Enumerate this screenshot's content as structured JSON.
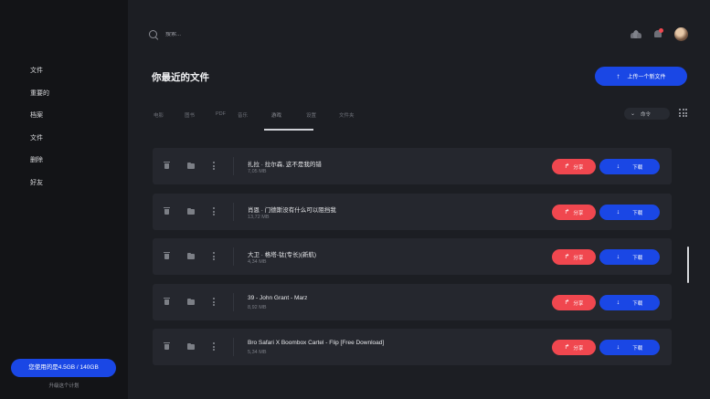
{
  "sidebar": {
    "items": [
      {
        "label": "文件"
      },
      {
        "label": "重要的"
      },
      {
        "label": "档案"
      },
      {
        "label": "文件"
      },
      {
        "label": "删除"
      },
      {
        "label": "好友"
      }
    ],
    "storage_label": "您使用的是4.5GB / 140GB",
    "upgrade_label": "升级这个计划"
  },
  "header": {
    "search_placeholder": "搜索..."
  },
  "main": {
    "title": "你最近的文件",
    "upload_label": "上传一个新文件",
    "tabs": [
      {
        "label": "电影",
        "active": false
      },
      {
        "label": "图书",
        "active": false
      },
      {
        "label": "PDF",
        "active": false
      },
      {
        "label": "音乐",
        "active": false
      },
      {
        "label": "游戏",
        "active": true
      },
      {
        "label": "设置",
        "active": false
      },
      {
        "label": "文件夹",
        "active": false
      }
    ],
    "sort_label": "命令",
    "files": [
      {
        "name": "扎拉 · 拉尔森, 这不是我的错",
        "size": "7,05 MB"
      },
      {
        "name": "肖恩 · 门德斯没有什么可以阻挡我",
        "size": "13,72 MB"
      },
      {
        "name": "大卫 · 格塔-钛(专长)(新航)",
        "size": "4,34 MB"
      },
      {
        "name": "39 - John Grant - Marz",
        "size": "8,92 MB"
      },
      {
        "name": "Bro Safari X Boombox Cartel - Flip [Free Download]",
        "size": "5,34 MB"
      }
    ],
    "share_label": "分享",
    "download_label": "下载"
  },
  "colors": {
    "accent": "#1a47e5",
    "share": "#f0474f",
    "background": "#1c1e23",
    "sidebar": "#131417",
    "row": "#25272e"
  },
  "icons": [
    "search-icon",
    "users-icon",
    "bell-icon",
    "avatar",
    "arrow-up-icon",
    "chevron-down-icon",
    "grid-view-icon",
    "trash-icon",
    "folder-icon",
    "more-icon",
    "share-icon",
    "arrow-down-icon"
  ]
}
